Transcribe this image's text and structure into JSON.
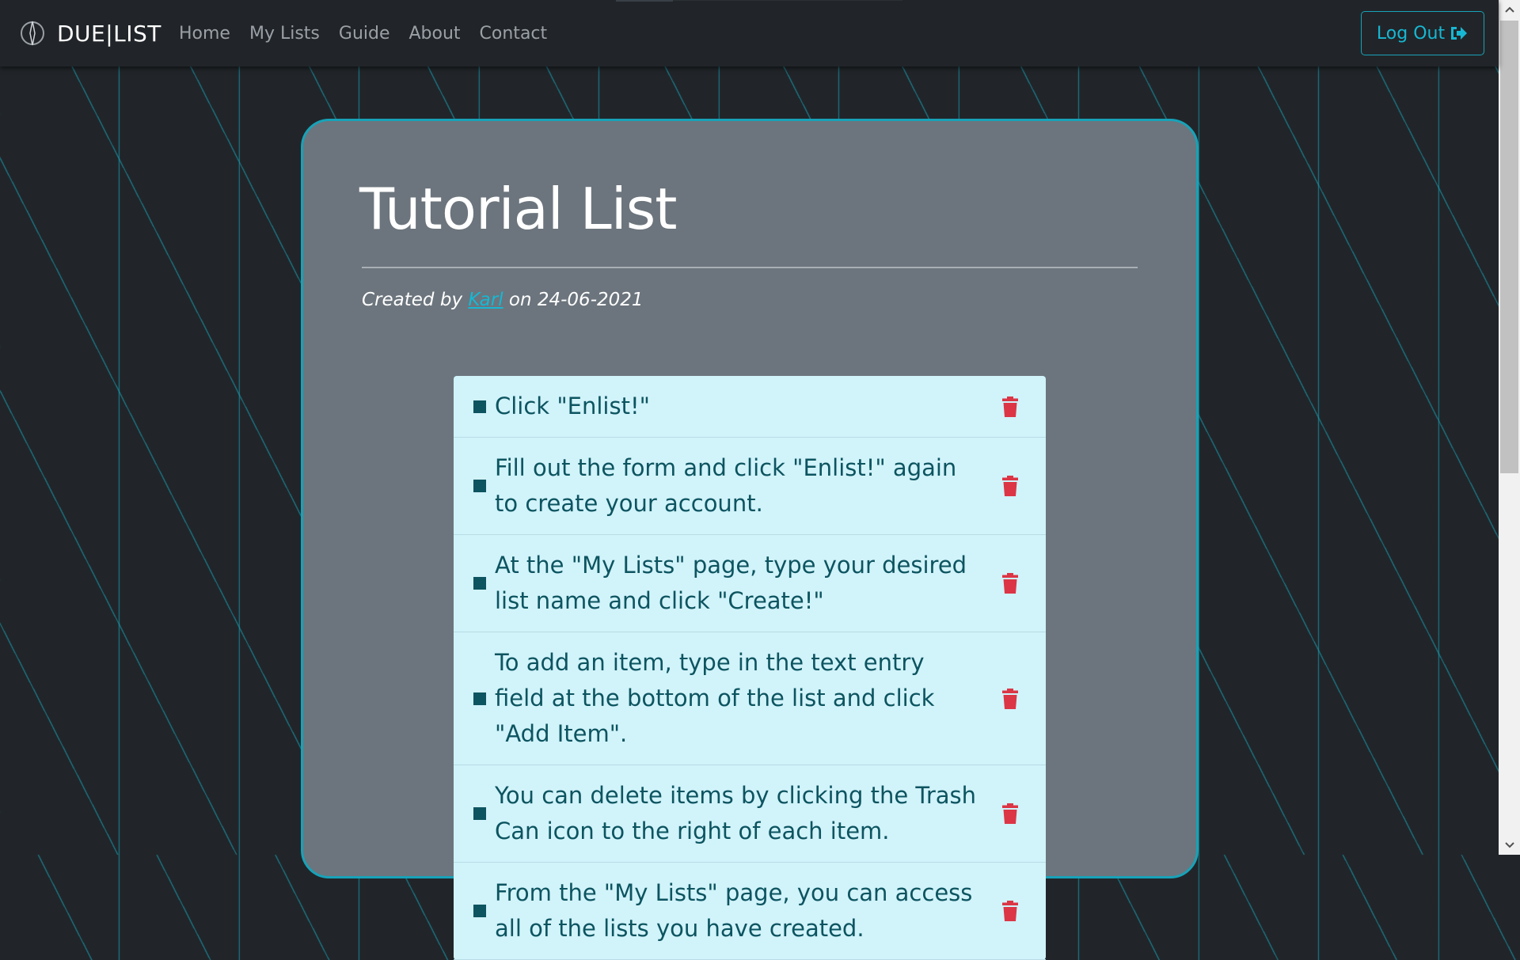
{
  "navbar": {
    "brand": "DUE|LIST",
    "links": [
      "Home",
      "My Lists",
      "Guide",
      "About",
      "Contact"
    ],
    "logout_label": "Log Out",
    "brand_icon": "compass-needle-icon",
    "logout_icon": "sign-out-icon"
  },
  "list": {
    "title": "Tutorial List",
    "created_prefix": "Created by",
    "author": "Karl",
    "created_mid": "on",
    "date": "24-06-2021",
    "items": [
      "Click \"Enlist!\"",
      "Fill out the form and click \"Enlist!\" again to create your account.",
      "At the \"My Lists\" page, type your desired list name and click \"Create!\"",
      "To add an item, type in the text entry field at the bottom of the list and click \"Add Item\".",
      "You can delete items by clicking the Trash Can icon to the right of each item.",
      "From the \"My Lists\" page, you can access all of the lists you have created."
    ]
  },
  "colors": {
    "accent": "#17a2b8",
    "card_bg": "#6c757d",
    "item_bg": "#d1f3fa",
    "item_text": "#0c5460",
    "trash": "#dc3545",
    "page_bg": "#212529"
  }
}
